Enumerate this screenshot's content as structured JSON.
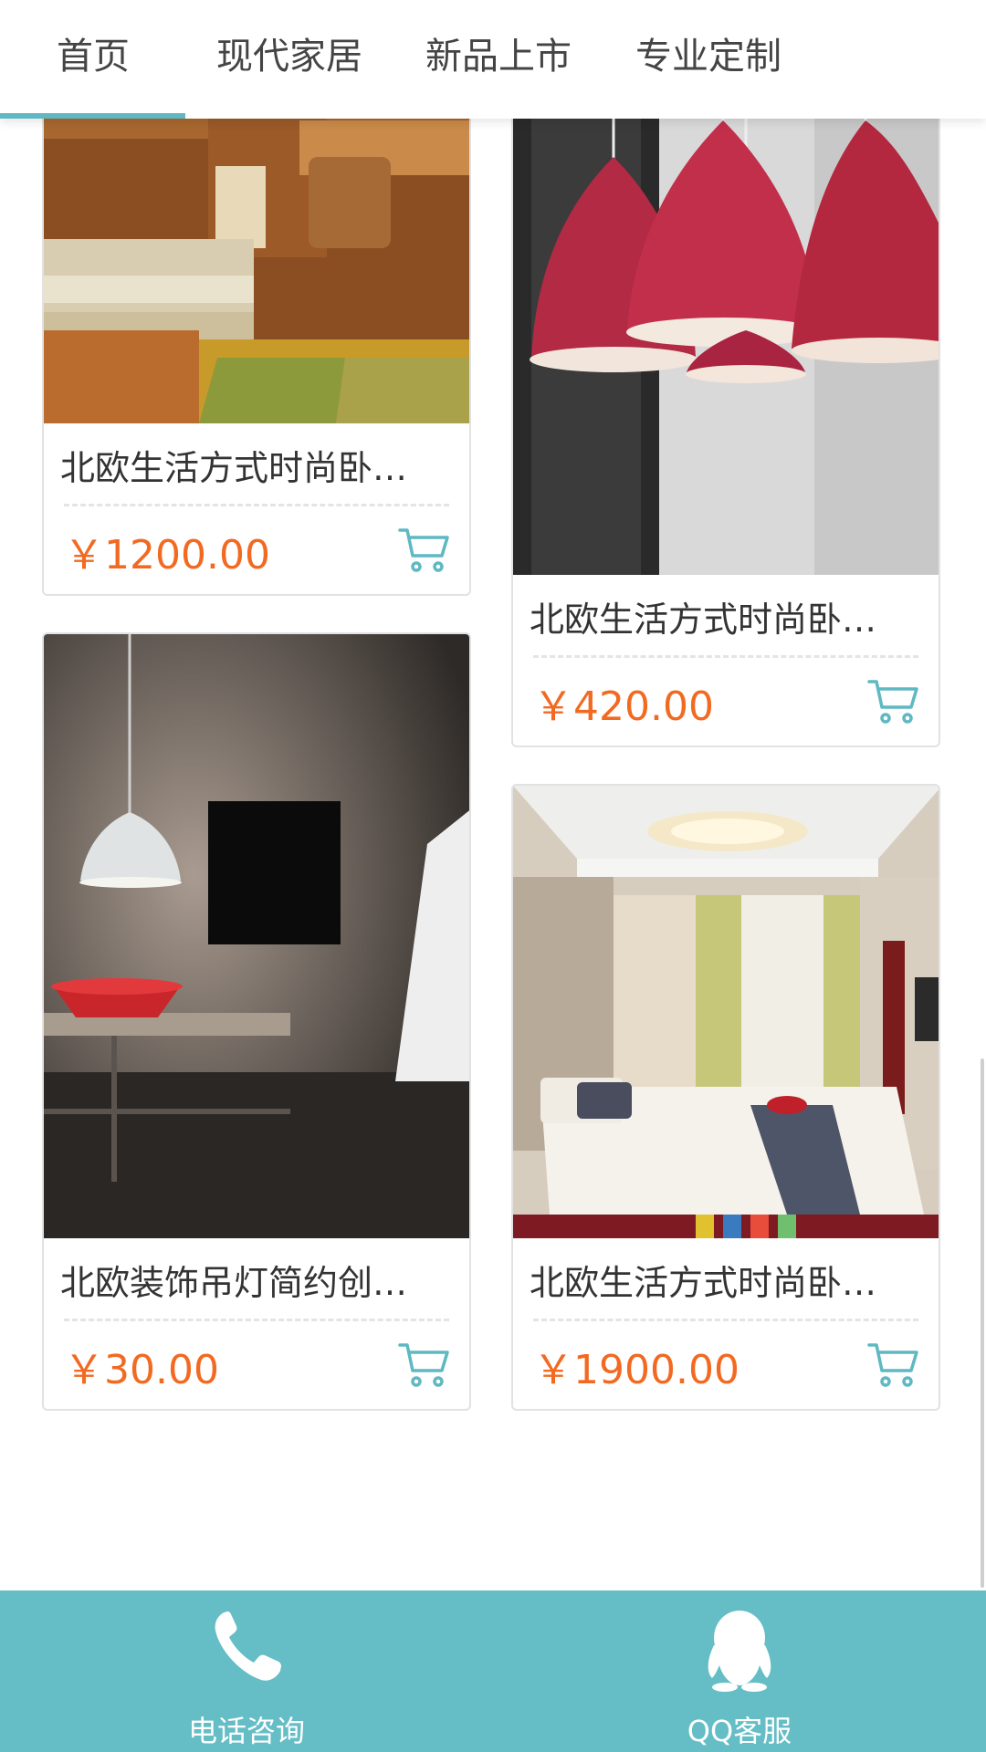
{
  "nav": {
    "tabs": [
      {
        "label": "首页",
        "active": true
      },
      {
        "label": "现代家居",
        "active": false
      },
      {
        "label": "新品上市",
        "active": false
      },
      {
        "label": "专业定制",
        "active": false
      }
    ],
    "accent_color": "#5fb8c2"
  },
  "products": [
    {
      "title": "北欧生活方式时尚卧…",
      "price": "￥1200.00",
      "image": "bedroom-desk-photo"
    },
    {
      "title": "北欧生活方式时尚卧…",
      "price": "￥420.00",
      "image": "red-pendant-lamps-photo"
    },
    {
      "title": "北欧装饰吊灯简约创…",
      "price": "￥30.00",
      "image": "white-pendant-lamp-photo"
    },
    {
      "title": "北欧生活方式时尚卧…",
      "price": "￥1900.00",
      "image": "bedroom-photo"
    }
  ],
  "colors": {
    "price": "#f26a22",
    "cart_icon": "#5fb8c2",
    "bottom_bar": "#65bdc5"
  },
  "bottom_bar": {
    "phone_label": "电话咨询",
    "qq_label": "QQ客服"
  }
}
